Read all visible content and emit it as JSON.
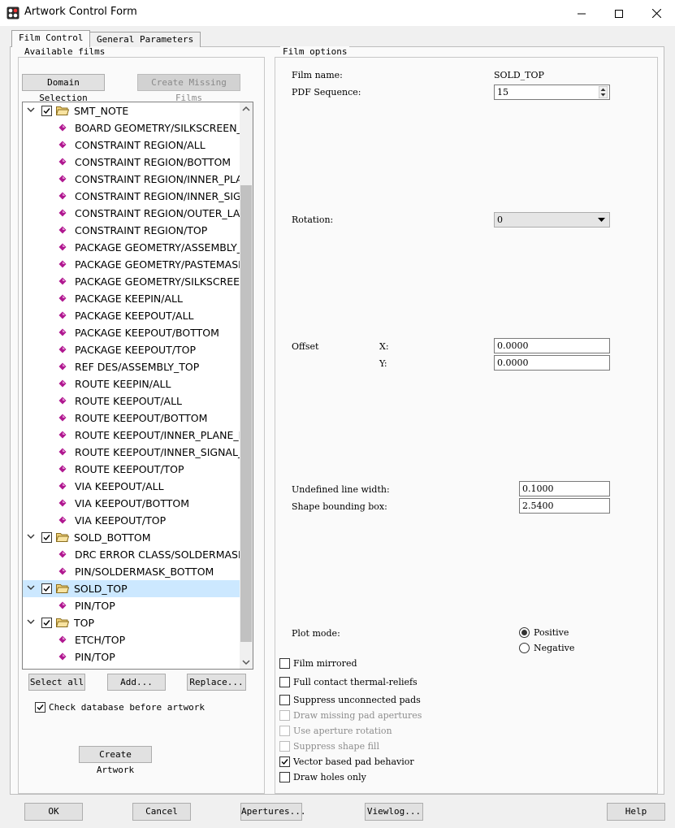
{
  "window": {
    "title": "Artwork Control Form"
  },
  "tabs": [
    "Film Control",
    "General Parameters"
  ],
  "available_films": {
    "label": "Available films",
    "domain_selection": "Domain Selection",
    "create_missing": "Create Missing Films",
    "tree": [
      {
        "type": "folder",
        "label": "SMT_NOTE",
        "checked": true
      },
      {
        "type": "leaf",
        "label": "BOARD GEOMETRY/SILKSCREEN_TOP"
      },
      {
        "type": "leaf",
        "label": "CONSTRAINT REGION/ALL"
      },
      {
        "type": "leaf",
        "label": "CONSTRAINT REGION/BOTTOM"
      },
      {
        "type": "leaf",
        "label": "CONSTRAINT REGION/INNER_PLANE_LAYERS"
      },
      {
        "type": "leaf",
        "label": "CONSTRAINT REGION/INNER_SIGNAL_LAYERS"
      },
      {
        "type": "leaf",
        "label": "CONSTRAINT REGION/OUTER_LAYERS"
      },
      {
        "type": "leaf",
        "label": "CONSTRAINT REGION/TOP"
      },
      {
        "type": "leaf",
        "label": "PACKAGE GEOMETRY/ASSEMBLY_TOP"
      },
      {
        "type": "leaf",
        "label": "PACKAGE GEOMETRY/PASTEMASK_TOP"
      },
      {
        "type": "leaf",
        "label": "PACKAGE GEOMETRY/SILKSCREEN_TOP"
      },
      {
        "type": "leaf",
        "label": "PACKAGE KEEPIN/ALL"
      },
      {
        "type": "leaf",
        "label": "PACKAGE KEEPOUT/ALL"
      },
      {
        "type": "leaf",
        "label": "PACKAGE KEEPOUT/BOTTOM"
      },
      {
        "type": "leaf",
        "label": "PACKAGE KEEPOUT/TOP"
      },
      {
        "type": "leaf",
        "label": "REF DES/ASSEMBLY_TOP"
      },
      {
        "type": "leaf",
        "label": "ROUTE KEEPIN/ALL"
      },
      {
        "type": "leaf",
        "label": "ROUTE KEEPOUT/ALL"
      },
      {
        "type": "leaf",
        "label": "ROUTE KEEPOUT/BOTTOM"
      },
      {
        "type": "leaf",
        "label": "ROUTE KEEPOUT/INNER_PLANE_LAYERS"
      },
      {
        "type": "leaf",
        "label": "ROUTE KEEPOUT/INNER_SIGNAL_LAYERS"
      },
      {
        "type": "leaf",
        "label": "ROUTE KEEPOUT/TOP"
      },
      {
        "type": "leaf",
        "label": "VIA KEEPOUT/ALL"
      },
      {
        "type": "leaf",
        "label": "VIA KEEPOUT/BOTTOM"
      },
      {
        "type": "leaf",
        "label": "VIA KEEPOUT/TOP"
      },
      {
        "type": "folder",
        "label": "SOLD_BOTTOM",
        "checked": true
      },
      {
        "type": "leaf",
        "label": "DRC ERROR CLASS/SOLDERMASK_BOTTOM"
      },
      {
        "type": "leaf",
        "label": "PIN/SOLDERMASK_BOTTOM"
      },
      {
        "type": "folder",
        "label": "SOLD_TOP",
        "checked": true,
        "selected": true
      },
      {
        "type": "leaf",
        "label": "PIN/TOP"
      },
      {
        "type": "folder",
        "label": "TOP",
        "checked": true
      },
      {
        "type": "leaf",
        "label": "ETCH/TOP"
      },
      {
        "type": "leaf",
        "label": "PIN/TOP"
      }
    ],
    "select_all": "Select all",
    "add": "Add...",
    "replace": "Replace...",
    "check_db": "Check database before artwork",
    "create_artwork": "Create Artwork"
  },
  "film_options": {
    "label": "Film options",
    "film_name_label": "Film name:",
    "film_name": "SOLD_TOP",
    "pdf_seq_label": "PDF Sequence:",
    "pdf_seq": "15",
    "rotation_label": "Rotation:",
    "rotation": "0",
    "offset_label": "Offset",
    "x_label": "X:",
    "y_label": "Y:",
    "x": "0.0000",
    "y": "0.0000",
    "undef_label": "Undefined line width:",
    "undef": "0.1000",
    "shape_label": "Shape bounding box:",
    "shape": "2.5400",
    "plot_mode_label": "Plot mode:",
    "positive": "Positive",
    "negative": "Negative",
    "checks": [
      {
        "label": "Film mirrored",
        "checked": false,
        "enabled": true
      },
      {
        "label": "Full contact thermal-reliefs",
        "checked": false,
        "enabled": true
      },
      {
        "label": "Suppress unconnected pads",
        "checked": false,
        "enabled": true
      },
      {
        "label": "Draw missing pad apertures",
        "checked": false,
        "enabled": false
      },
      {
        "label": "Use aperture rotation",
        "checked": false,
        "enabled": false
      },
      {
        "label": "Suppress shape fill",
        "checked": false,
        "enabled": false
      },
      {
        "label": "Vector based pad behavior",
        "checked": true,
        "enabled": true
      },
      {
        "label": "Draw holes only",
        "checked": false,
        "enabled": true
      }
    ]
  },
  "bottom": {
    "ok": "OK",
    "cancel": "Cancel",
    "apertures": "Apertures...",
    "viewlog": "Viewlog...",
    "help": "Help"
  },
  "colors": {
    "selection": "#cce8ff",
    "leaf_icon": "#b01890",
    "folder": "#f2d27a"
  }
}
